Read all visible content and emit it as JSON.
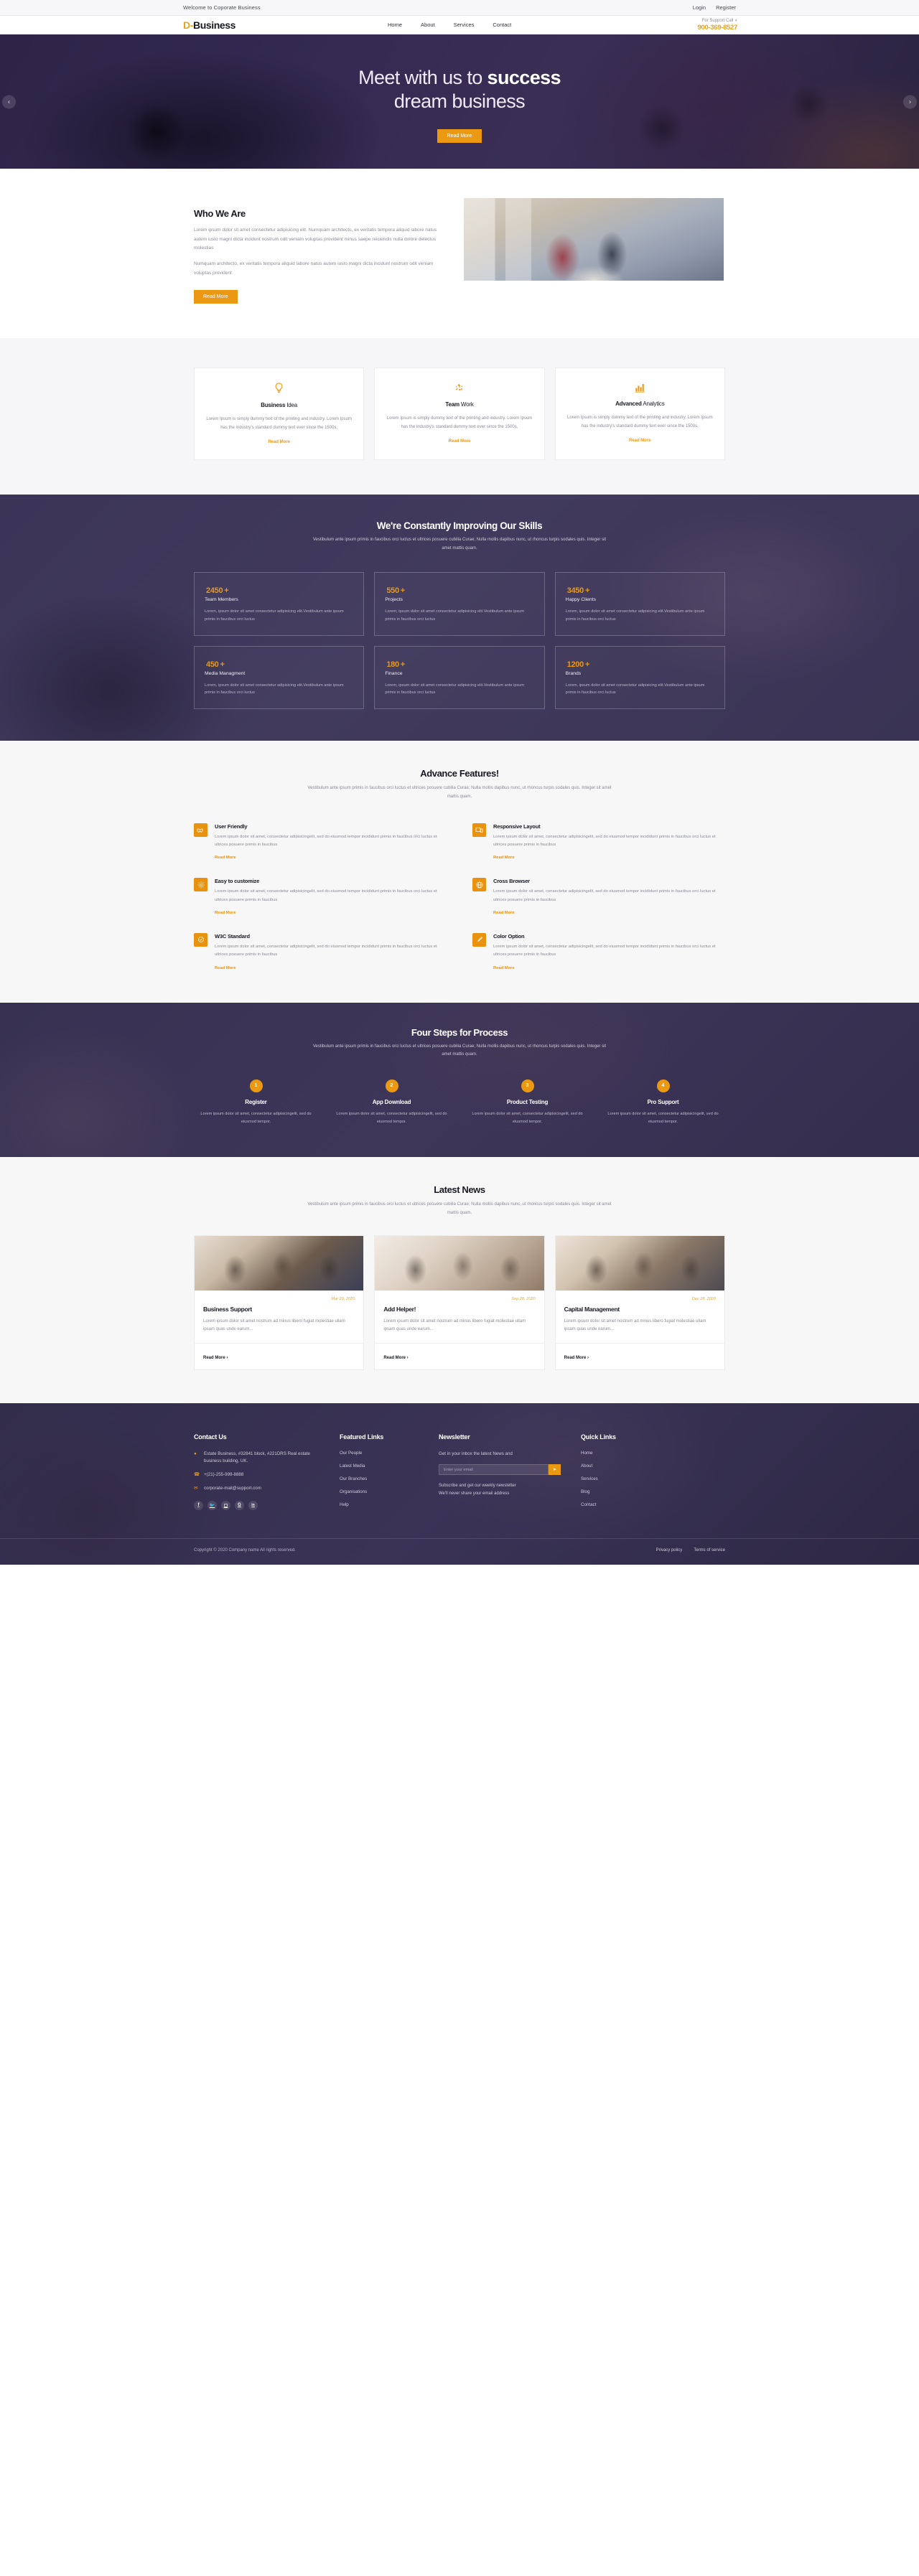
{
  "topbar": {
    "welcome": "Welcome to Coporate Business",
    "login": "Login",
    "register": "Register"
  },
  "header": {
    "logo_mark": "D",
    "logo_dash": "-",
    "logo_text": "Business",
    "nav": [
      {
        "label": "Home"
      },
      {
        "label": "About"
      },
      {
        "label": "Services"
      },
      {
        "label": "Contact"
      }
    ],
    "support_label": "For Support Call",
    "support_icon": "headphone-icon",
    "support_number": "900-369-8527"
  },
  "hero": {
    "line1_light": "Meet with us to ",
    "line1_bold": "success",
    "line2": "dream business",
    "button": "Read More",
    "prev_icon": "chevron-left-icon",
    "next_icon": "chevron-right-icon"
  },
  "who": {
    "title": "Who We Are",
    "p1": "Lorem ipsum dolor sit amet consectetur adipisicing elit. Numquam architecto, ex veritatis tempora aliquid labore natus autem iusto magni dicta incidunt nostrum odit veniam voluptas provident minus saepe reiciendis nulla dolore delectus molestias",
    "p2": "Numquam architecto, ex veritatis tempora aliquid labore natus autem iusto magni dicta incidunt nostrum odit veniam voluptas provident",
    "button": "Read More"
  },
  "cards": [
    {
      "icon": "lightbulb-icon",
      "glyph": "☀",
      "title_bold": "Business",
      "title_rest": " Idea",
      "text": "Lorem Ipsum is simply dummy text of the printing and industry. Lorem Ipsum has the industry's standard dummy text ever since the 1500s,",
      "link": "Read More"
    },
    {
      "icon": "recycle-icon",
      "glyph": "♻",
      "title_bold": "Team",
      "title_rest": " Work",
      "text": "Lorem Ipsum is simply dummy text of the printing and industry. Lorem Ipsum has the industry's standard dummy text ever since the 1500s,",
      "link": "Read More"
    },
    {
      "icon": "bar-chart-icon",
      "glyph": "ὌA",
      "title_bold": "Advanced",
      "title_rest": " Analytics",
      "text": "Lorem Ipsum is simply dummy text of the printing and industry. Lorem Ipsum has the industry's standard dummy text ever since the 1500s,",
      "link": "Read More"
    }
  ],
  "skills": {
    "title": "We're Constantly Improving Our Skills",
    "subtitle": "Vestibulum ante ipsum primis in faucibus orci luctus et ultrices posuere cubilia Curae; Nulla mollis dapibus nunc, ut rhoncus turpis sodales quis. Integer sit amet mattis quam.",
    "counters": [
      {
        "number": "2450",
        "plus": "+",
        "label": "Team Members",
        "desc": "Lorem, ipsum dolor sit amet consectetur adipisicing elit.Vestibulum ante ipsum primis in faucibus orci luctus"
      },
      {
        "number": "550",
        "plus": "+",
        "label": "Projects",
        "desc": "Lorem, ipsum dolor sit amet consectetur adipisicing elit.Vestibulum ante ipsum primis in faucibus orci luctus"
      },
      {
        "number": "3450",
        "plus": "+",
        "label": "Happy Clients",
        "desc": "Lorem, ipsum dolor sit amet consectetur adipisicing elit.Vestibulum ante ipsum primis in faucibus orci luctus"
      },
      {
        "number": "450",
        "plus": "+",
        "label": "Media Managment",
        "desc": "Lorem, ipsum dolor sit amet consectetur adipisicing elit.Vestibulum ante ipsum primis in faucibus orci luctus"
      },
      {
        "number": "180",
        "plus": "+",
        "label": "Finance",
        "desc": "Lorem, ipsum dolor sit amet consectetur adipisicing elit.Vestibulum ante ipsum primis in faucibus orci luctus"
      },
      {
        "number": "1200",
        "plus": "+",
        "label": "Brands",
        "desc": "Lorem, ipsum dolor sit amet consectetur adipisicing elit.Vestibulum ante ipsum primis in faucibus orci luctus"
      }
    ]
  },
  "advance": {
    "title": "Advance Features!",
    "subtitle": "Vestibulum ante ipsum primis in faucibus orci luctus et ultrices posuere cubilia Curae; Nulla mollis dapibus nunc, ut rhoncus turpis sodales quis. Integer sit amet mattis quam.",
    "items": [
      {
        "icon": "handshake-icon",
        "glyph": "✋",
        "title": "User Friendly",
        "text": "Lorem ipsum dolor sit amet, consectetur adipisicingelit, sed do eiusmod tempor incididunt primis in faucibus orci luctus et ultrices posuere primis in faucibus",
        "link": "Read More"
      },
      {
        "icon": "responsive-layout-icon",
        "glyph": "▣",
        "title": "Responsive Layout",
        "text": "Lorem ipsum dolor sit amet, consectetur adipisicingelit, sed do eiusmod tempor incididunt primis in faucibus orci luctus et ultrices posuere primis in faucibus",
        "link": "Read More"
      },
      {
        "icon": "gear-icon",
        "glyph": "⚙",
        "title": "Easy to customize",
        "text": "Lorem ipsum dolor sit amet, consectetur adipisicingelit, sed do eiusmod tempor incididunt primis in faucibus orci luctus et ultrices posuere primis in faucibus",
        "link": "Read More"
      },
      {
        "icon": "globe-icon",
        "glyph": "⊕",
        "title": "Cross Browser",
        "text": "Lorem ipsum dolor sit amet, consectetur adipisicingelit, sed do eiusmod tempor incididunt primis in faucibus orci luctus et ultrices posuere primis in faucibus",
        "link": "Read More"
      },
      {
        "icon": "w3c-standard-icon",
        "glyph": "✔",
        "title": "W3C Standard",
        "text": "Lorem ipsum dolor sit amet, consectetur adipisicingelit, sed do eiusmod tempor incididunt primis in faucibus orci luctus et ultrices posuere primis in faucibus",
        "link": "Read More"
      },
      {
        "icon": "paintbrush-icon",
        "glyph": "✒",
        "title": "Color Option",
        "text": "Lorem ipsum dolor sit amet, consectetur adipisicingelit, sed do eiusmod tempor incididunt primis in faucibus orci luctus et ultrices posuere primis in faucibus",
        "link": "Read More"
      }
    ]
  },
  "steps": {
    "title": "Four Steps for Process",
    "subtitle": "Vestibulum ante ipsum primis in faucibus orci luctus et ultrices posuere cubilia Curae; Nulla mollis dapibus nunc, ut rhoncus turpis sodales quis. Integer sit amet mattis quam.",
    "items": [
      {
        "num": "1",
        "title": "Register",
        "text": "Lorem ipsum dolor sit amet, consectetur adipisicingelit, sed do eiusmod tempor."
      },
      {
        "num": "2",
        "title": "App Download",
        "text": "Lorem ipsum dolor sit amet, consectetur adipisicingelit, sed do eiusmod tempor."
      },
      {
        "num": "3",
        "title": "Product Testing",
        "text": "Lorem ipsum dolor sit amet, consectetur adipisicingelit, sed do eiusmod tempor."
      },
      {
        "num": "4",
        "title": "Pro Support",
        "text": "Lorem ipsum dolor sit amet, consectetur adipisicingelit, sed do eiusmod tempor."
      }
    ]
  },
  "news": {
    "title": "Latest News",
    "subtitle": "Vestibulum ante ipsum primis in faucibus orci luctus et ultrices posuere cubilia Curae; Nulla mollis dapibus nunc, ut rhoncus turpis sodales quis. Integer sit amet mattis quam.",
    "items": [
      {
        "date": "Mar 29, 2020",
        "title": "Business Support",
        "text": "Lorem ipsum dolor sit amet nostrum ad minus libero fugiat molestiae ullam ipsam quas unde earum...",
        "link": "Read More ›"
      },
      {
        "date": "Sep 28, 2020",
        "title": "Add Helper!",
        "text": "Lorem ipsum dolor sit amet nostrum ad minus libero fugiat molestiae ullam ipsam quas unde earum...",
        "link": "Read More ›"
      },
      {
        "date": "Dec 28, 2020",
        "title": "Capital Management",
        "text": "Lorem ipsum dolor sit amet nostrum ad minus libero fugiat molestiae ullam ipsam quas unde earum...",
        "link": "Read More ›"
      }
    ]
  },
  "footer": {
    "contact": {
      "title": "Contact Us",
      "address": "Estate Business, #32841 block, #221DRS Real estate business building, UK.",
      "phone": "+(21)-255-999-8888",
      "email": "corporate-mail@support.com",
      "socials": [
        {
          "name": "facebook-icon",
          "glyph": "f"
        },
        {
          "name": "twitter-icon",
          "glyph": "ᵥ"
        },
        {
          "name": "instagram-icon",
          "glyph": "▢"
        },
        {
          "name": "google-plus-icon",
          "glyph": "G"
        },
        {
          "name": "linkedin-icon",
          "glyph": "in"
        }
      ]
    },
    "featured": {
      "title": "Featured Links",
      "links": [
        "Our People",
        "Latest Media",
        "Our Branches",
        "Organisations",
        "Help"
      ]
    },
    "newsletter": {
      "title": "Newsletter",
      "desc": "Get in your inbox the latest News and",
      "placeholder": "Enter your email",
      "button_icon": "send-icon",
      "button_glyph": "➤",
      "note_line1": "Subscribe and get our weekly newsletter",
      "note_line2": "We'll never share your email address"
    },
    "quick": {
      "title": "Quick Links",
      "links": [
        "Home",
        "About",
        "Services",
        "Blog",
        "Contact"
      ]
    },
    "copyright": "Copyright © 2020 Company name All rights reserved.",
    "policy_links": [
      "Privacy policy",
      "Terms of service"
    ]
  },
  "colors": {
    "accent": "#eb9913",
    "dark": "#3a3356",
    "text": "#191923",
    "muted": "#8a8a96"
  }
}
